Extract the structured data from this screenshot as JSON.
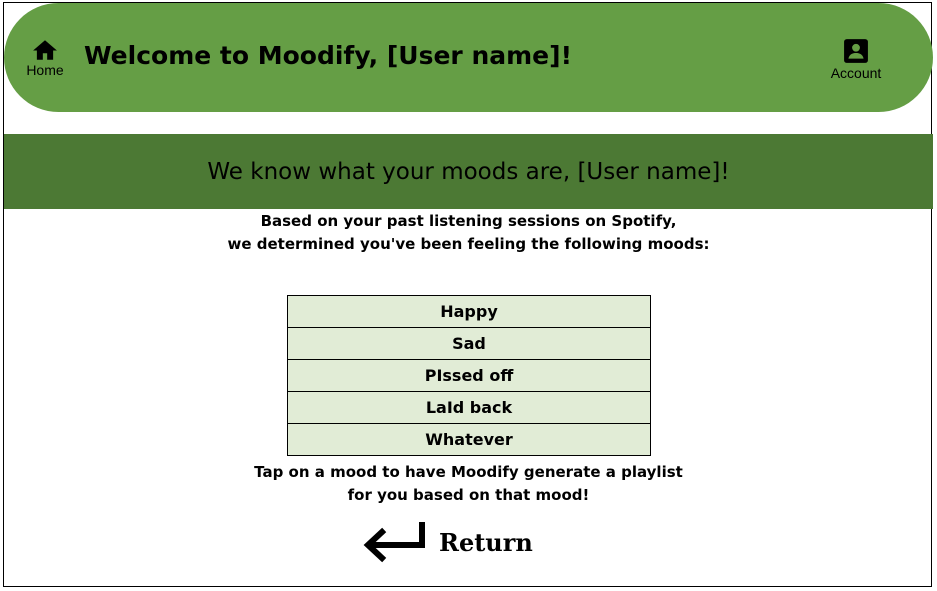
{
  "header": {
    "title": "Welcome to Moodify, [User name]!",
    "home_label": "Home",
    "account_label": "Account",
    "home_icon": "home-icon",
    "account_icon": "account-box-icon",
    "background_color": "#659e45"
  },
  "banner": {
    "text": "We know what your moods are, [User name]!",
    "background_color": "#4c7934"
  },
  "intro": {
    "line1": "Based on your past listening sessions on Spotify,",
    "line2": "we determined you've been feeling the following moods:"
  },
  "moods": [
    "Happy",
    "Sad",
    "PIssed off",
    "LaId back",
    "Whatever"
  ],
  "mood_cell_color": "#e1ecd6",
  "tap_hint": {
    "line1": "Tap on a mood to have Moodify generate a playlist",
    "line2": "for you based on that mood!"
  },
  "return": {
    "label": "Return",
    "icon": "return-arrow-icon"
  }
}
